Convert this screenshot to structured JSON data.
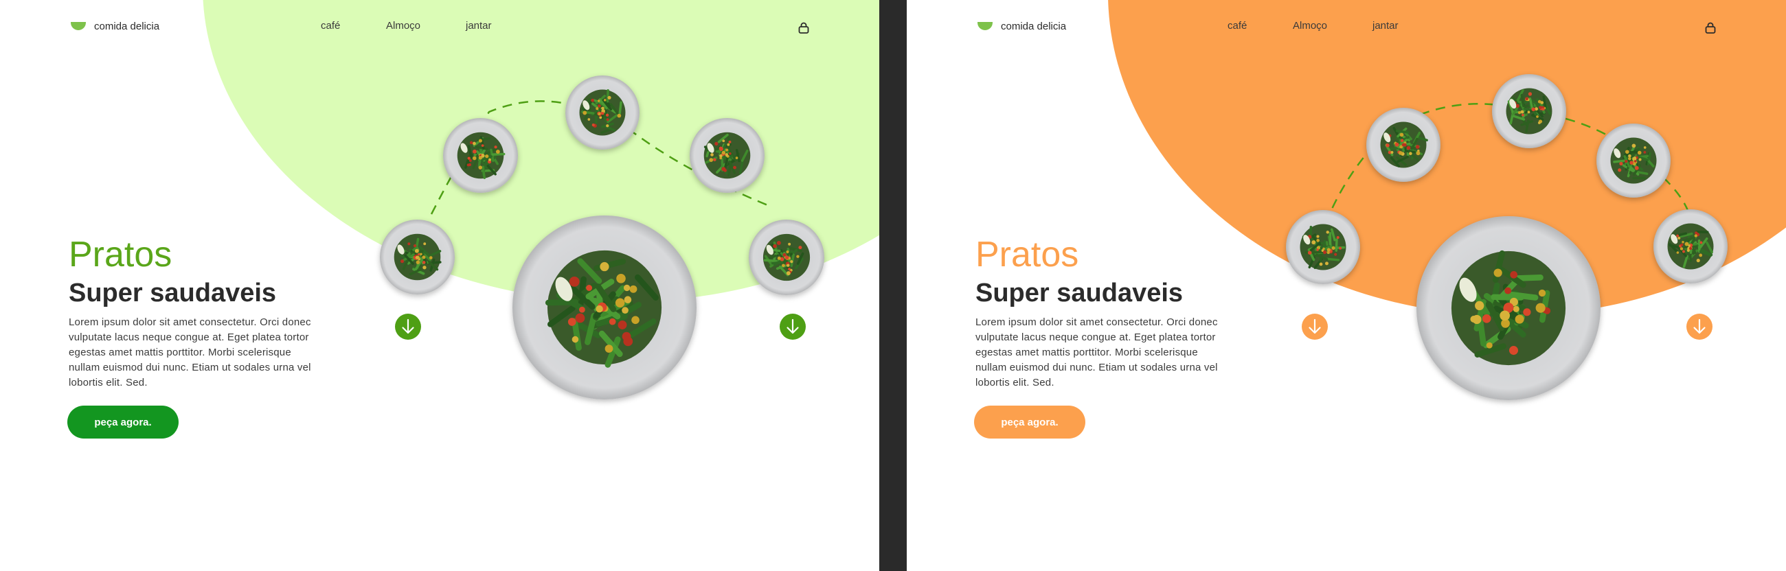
{
  "panels": [
    {
      "theme": {
        "accent": "#5aa61a",
        "blob": "#dbfcb6",
        "button": "#139620",
        "arrow": "#4e9f14",
        "bowl": "#7ec24b"
      },
      "brand": "comida delicia",
      "nav": [
        "café",
        "Almoço",
        "jantar"
      ],
      "hero": {
        "title": "Pratos",
        "subtitle": "Super saudaveis",
        "body": "Lorem ipsum dolor sit amet consectetur. Orci donec vulputate lacus neque congue at. Eget platea tortor egestas amet mattis porttitor. Morbi scelerisque nullam euismod dui nunc. Etiam ut sodales urna vel lobortis elit. Sed.",
        "cta": "peça agora."
      },
      "icons": {
        "logo": "bowl-icon",
        "cart": "lock-bag-icon",
        "arrows": "arrow-down-circle-icon",
        "dishes": "vegetable-plate-icon"
      }
    },
    {
      "theme": {
        "accent": "#fca04d",
        "blob": "#fca04d",
        "button": "#fca04d",
        "arrow": "#fca04d",
        "bowl": "#7ec24b"
      },
      "brand": "comida delicia",
      "nav": [
        "café",
        "Almoço",
        "jantar"
      ],
      "hero": {
        "title": "Pratos",
        "subtitle": "Super saudaveis",
        "body": "Lorem ipsum dolor sit amet consectetur. Orci donec vulputate lacus neque congue at. Eget platea tortor egestas amet mattis porttitor. Morbi scelerisque nullam euismod dui nunc. Etiam ut sodales urna vel lobortis elit. Sed.",
        "cta": "peça agora."
      },
      "icons": {
        "logo": "bowl-icon",
        "cart": "lock-bag-icon",
        "arrows": "arrow-down-circle-icon",
        "dishes": "vegetable-plate-icon"
      }
    }
  ]
}
